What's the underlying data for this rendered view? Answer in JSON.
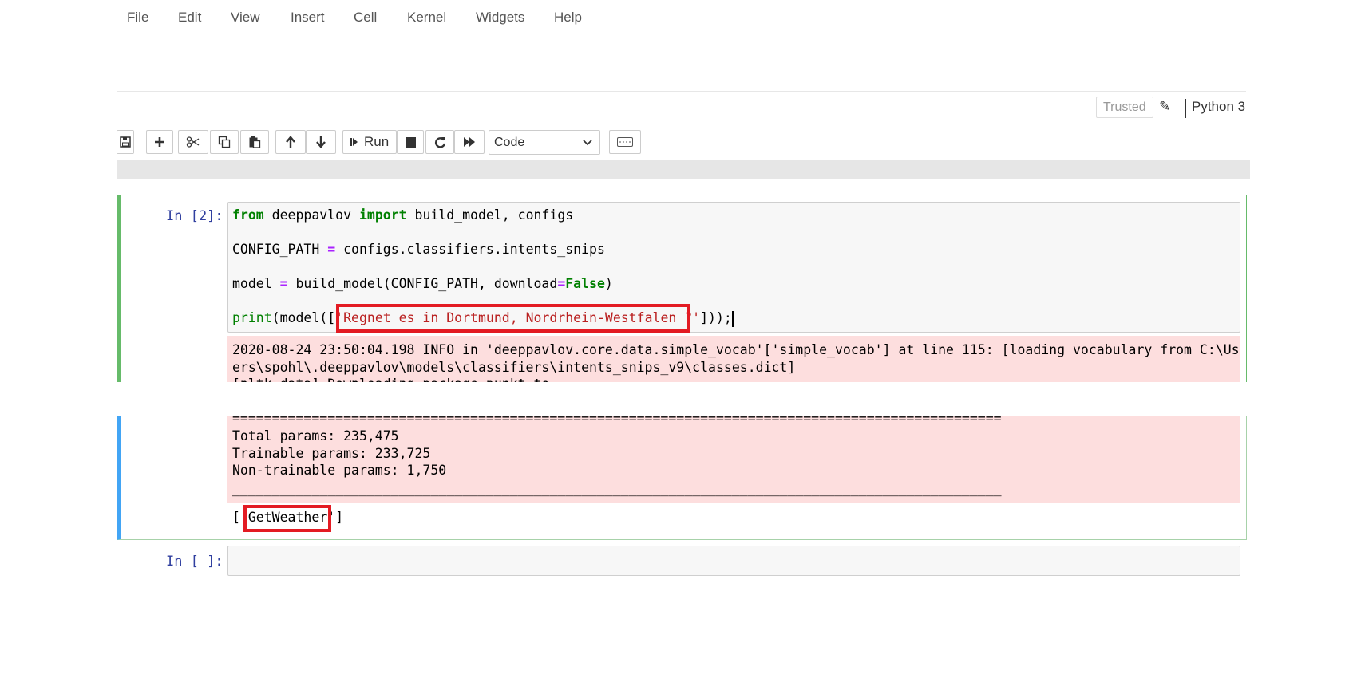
{
  "menubar": {
    "items": [
      "File",
      "Edit",
      "View",
      "Insert",
      "Cell",
      "Kernel",
      "Widgets",
      "Help"
    ],
    "trusted_label": "Trusted",
    "kernel_name": "Python 3"
  },
  "toolbar": {
    "run_label": "Run",
    "cell_type": "Code",
    "icons": [
      "save-icon",
      "plus-icon",
      "scissors-icon",
      "copy-icon",
      "paste-icon",
      "arrow-up-icon",
      "arrow-down-icon",
      "run-icon",
      "stop-icon",
      "restart-icon",
      "fast-forward-icon",
      "keyboard-icon"
    ]
  },
  "cell1": {
    "prompt": "In [2]:",
    "code": {
      "l1_kw1": "from",
      "l1_mid": " deeppavlov ",
      "l1_kw2": "import",
      "l1_rest": " build_model, configs",
      "l2_a": "CONFIG_PATH ",
      "l2_op": "=",
      "l2_b": " configs.classifiers.intents_snips",
      "l3_a": "model ",
      "l3_op": "=",
      "l3_b": " build_model(CONFIG_PATH, download",
      "l3_op2": "=",
      "l3_kw": "False",
      "l3_c": ")",
      "l4_fn": "print",
      "l4_a": "(model([",
      "l4_str": "'Regnet es in Dortmund, Nordrhein-Westfalen ?'",
      "l4_b": "]));"
    },
    "stderr_lines": [
      "2020-08-24 23:50:04.198 INFO in 'deeppavlov.core.data.simple_vocab'['simple_vocab'] at line 115: [loading vocabulary from C:\\Us",
      "ers\\spohl\\.deeppavlov\\models\\classifiers\\intents_snips_v9\\classes.dict]",
      "[nltk_data] Downloading package punkt to"
    ]
  },
  "cell1_output_tail": {
    "separator": "=================================================================================================",
    "lines": [
      "Total params: 235,475",
      "Trainable params: 233,725",
      "Non-trainable params: 1,750"
    ],
    "underline": "_________________________________________________________________________________________________",
    "result_open": "[",
    "result_value": "'GetWeather'",
    "result_close": "]"
  },
  "cell2": {
    "prompt": "In [ ]:"
  }
}
